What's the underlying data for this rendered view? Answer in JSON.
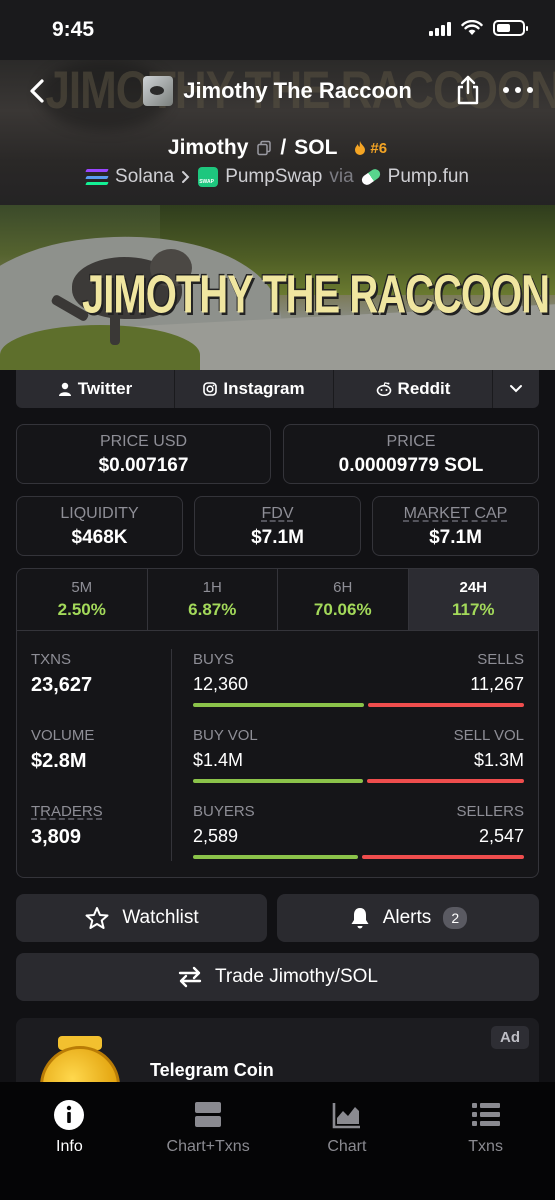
{
  "status_bar": {
    "time": "9:45"
  },
  "header": {
    "token_title": "Jimothy The Raccoon",
    "banner_watermark": "JIMOTHY THE RACCOON",
    "pair_base": "Jimothy",
    "pair_separator": "/",
    "pair_quote": "SOL",
    "rank": "#6",
    "chain": "Solana",
    "dex": "PumpSwap",
    "via_label": "via",
    "launchpad": "Pump.fun"
  },
  "banner": {
    "title": "JIMOTHY THE RACCOON"
  },
  "socials": [
    {
      "label": "Twitter",
      "icon": "person-icon"
    },
    {
      "label": "Instagram",
      "icon": "instagram-icon"
    },
    {
      "label": "Reddit",
      "icon": "reddit-icon"
    }
  ],
  "price": {
    "usd_label": "PRICE USD",
    "usd_value": "$0.007167",
    "native_label": "PRICE",
    "native_value": "0.00009779 SOL"
  },
  "metrics": {
    "liquidity_label": "LIQUIDITY",
    "liquidity_value": "$468K",
    "fdv_label": "FDV",
    "fdv_value": "$7.1M",
    "mcap_label": "MARKET CAP",
    "mcap_value": "$7.1M"
  },
  "timeframes": [
    {
      "label": "5M",
      "value": "2.50%"
    },
    {
      "label": "1H",
      "value": "6.87%"
    },
    {
      "label": "6H",
      "value": "70.06%"
    },
    {
      "label": "24H",
      "value": "117%"
    }
  ],
  "active_timeframe": "24H",
  "stats": {
    "txns_label": "TXNS",
    "txns_value": "23,627",
    "volume_label": "VOLUME",
    "volume_value": "$2.8M",
    "traders_label": "TRADERS",
    "traders_value": "3,809",
    "buys_label": "BUYS",
    "buys_value": "12,360",
    "sells_label": "SELLS",
    "sells_value": "11,267",
    "buy_vol_label": "BUY VOL",
    "buy_vol_value": "$1.4M",
    "sell_vol_label": "SELL VOL",
    "sell_vol_value": "$1.3M",
    "buyers_label": "BUYERS",
    "buyers_value": "2,589",
    "sellers_label": "SELLERS",
    "sellers_value": "2,547",
    "buys_fraction": 0.523,
    "buy_vol_fraction": 0.519,
    "buyers_fraction": 0.504
  },
  "actions": {
    "watchlist_label": "Watchlist",
    "alerts_label": "Alerts",
    "alerts_count": "2",
    "trade_label": "Trade Jimothy/SOL"
  },
  "ad": {
    "badge": "Ad",
    "title": "Telegram Coin"
  },
  "bottom_nav": [
    {
      "label": "Info",
      "icon": "info-icon"
    },
    {
      "label": "Chart+Txns",
      "icon": "chart-txns-icon"
    },
    {
      "label": "Chart",
      "icon": "chart-icon"
    },
    {
      "label": "Txns",
      "icon": "list-icon"
    }
  ],
  "colors": {
    "positive": "#a3d95a",
    "buy_bar": "#8bc34a",
    "sell_bar": "#ef4d4d",
    "rank": "#f5a524"
  }
}
